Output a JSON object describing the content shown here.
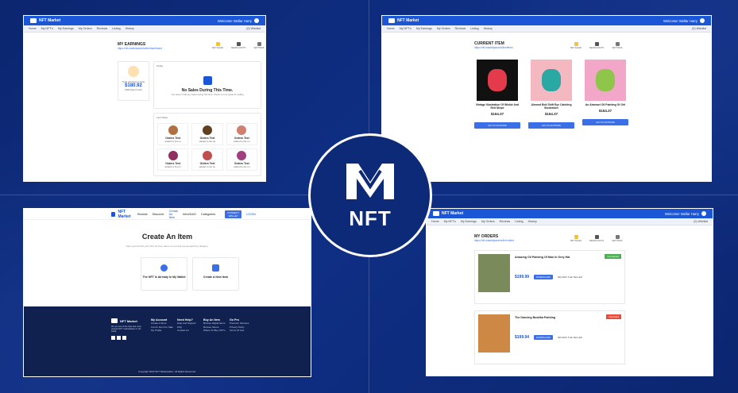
{
  "brand": {
    "name": "NFT Market",
    "center_label": "NFT"
  },
  "common": {
    "welcome": "Welcome! Stellar Harry",
    "nav": [
      "Home",
      "My NFT's",
      "My Earnings",
      "My Orders",
      "Reviews",
      "Listing",
      "History"
    ],
    "wishlist": "(0) Wishlist",
    "quick": [
      "SET SALES",
      "SEARCH NFTS",
      "SETTINGS"
    ]
  },
  "earnings": {
    "title": "MY EARNINGS",
    "link": "https://nft-marketplace/seller/dashboard",
    "total_label": "Total earnings to date",
    "total_value": "$180.92",
    "withdraw": "Withdraw Funds",
    "today_label": "Today",
    "empty_title": "No Sales During This Time.",
    "empty_text": "You haven't had any sales during this time. Check out our guide for selling",
    "last_sales": "Last Sales",
    "sales": [
      {
        "name": "Orders Text",
        "sub": "added to list on"
      },
      {
        "name": "Orders Text",
        "sub": "added to list on"
      },
      {
        "name": "Orders Text",
        "sub": "added to list on"
      },
      {
        "name": "Orders Text",
        "sub": "added to list on"
      },
      {
        "name": "Orders Text",
        "sub": "added to list on"
      },
      {
        "name": "Orders Text",
        "sub": "added to list on"
      }
    ]
  },
  "current": {
    "title": "CURRENT ITEM",
    "link": "https://nft-marketplace/seller/items",
    "items": [
      {
        "name": "Vintage Illustration Of Wiskie And Red Stripe",
        "price": "$164.37",
        "btn": "GO TO ACTIONS",
        "color": "#111",
        "accent": "#e33b4b"
      },
      {
        "name": "Almond Bolt Shift Eye Catching Illustration",
        "price": "$164.37",
        "btn": "GO TO ACTIONS",
        "color": "#f3b8c0",
        "accent": "#2aa8a3"
      },
      {
        "name": "An Abstract Oil Painting Of Girl",
        "price": "$164.37",
        "btn": "GO TO ACTIONS",
        "color": "#f2a7c8",
        "accent": "#8ec54a"
      }
    ]
  },
  "create": {
    "nav": [
      "Browse",
      "Discover",
      "Create An Item",
      "Infra/DAO",
      "Categories"
    ],
    "connect": "CONNECT WALLET",
    "login": "LOGIN",
    "title": "Create An Item",
    "desc": "Here you can list your item for free. Items on our site are grouped by category.",
    "opt1": "The NFT Is Already In My Wallet",
    "opt2": "Create A New Item",
    "footer_about": "We are one of the best and most popular NFT marketplaces in the world.",
    "footer_cols": [
      {
        "head": "My Account",
        "items": [
          "Create A Store",
          "List An Item For Sale",
          "My Profile"
        ]
      },
      {
        "head": "Need Help?",
        "items": [
          "Help And Support",
          "FAQ",
          "Contact Us"
        ]
      },
      {
        "head": "Buy An Item",
        "items": [
          "Browse Digital Items",
          "Browse Stores",
          "Where To Buy NFT's"
        ]
      },
      {
        "head": "Go Pro",
        "items": [
          "Premium Services",
          "Privacy Policy",
          "Terms Of Use"
        ]
      }
    ],
    "copyright": "Copyright 2022 NFT Marketplace. All Rights Reserved."
  },
  "orders": {
    "title": "MY ORDERS",
    "link": "https://nft-marketplace/seller/orders",
    "list": [
      {
        "name": "Amazing Oil Painting Of Man In Grey Hat",
        "status": "Completed",
        "price": "$199.99",
        "dl": "DOWNLOAD",
        "rev": "REVIEW THE SELLER",
        "status_color": "#4caf50"
      },
      {
        "name": "The Dancing Buddha Painting",
        "status": "Canceled",
        "price": "$199.94",
        "dl": "DOWNLOAD",
        "rev": "REVIEW THE SELLER",
        "status_color": "#e74c3c"
      }
    ]
  },
  "colors": {
    "primary": "#1a56d6",
    "bg": "#0d2a78"
  }
}
